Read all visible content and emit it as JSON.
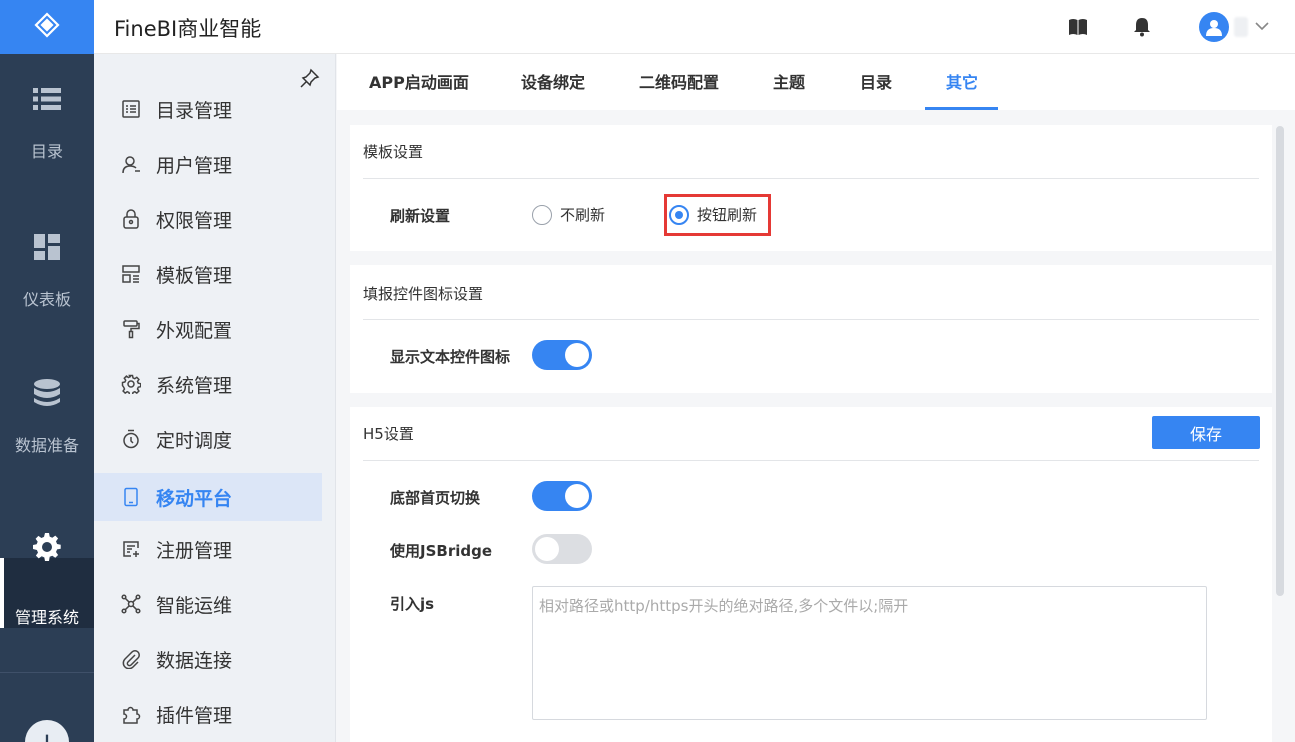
{
  "app": {
    "title": "FineBI商业智能"
  },
  "rail": {
    "items": [
      {
        "label": "目录",
        "icon": "list-icon"
      },
      {
        "label": "仪表板",
        "icon": "dashboard-icon"
      },
      {
        "label": "数据准备",
        "icon": "database-icon"
      },
      {
        "label": "管理系统",
        "icon": "gear-icon",
        "active": true
      }
    ],
    "add_label": "+"
  },
  "submenu": {
    "items": [
      {
        "label": "目录管理",
        "icon": "catalog-icon"
      },
      {
        "label": "用户管理",
        "icon": "user-icon"
      },
      {
        "label": "权限管理",
        "icon": "lock-icon"
      },
      {
        "label": "模板管理",
        "icon": "template-icon"
      },
      {
        "label": "外观配置",
        "icon": "paint-roller-icon"
      },
      {
        "label": "系统管理",
        "icon": "settings-icon"
      },
      {
        "label": "定时调度",
        "icon": "stopwatch-icon"
      },
      {
        "label": "移动平台",
        "icon": "mobile-icon",
        "active": true
      },
      {
        "label": "注册管理",
        "icon": "register-icon"
      },
      {
        "label": "智能运维",
        "icon": "network-icon"
      },
      {
        "label": "数据连接",
        "icon": "paperclip-icon"
      },
      {
        "label": "插件管理",
        "icon": "puzzle-icon"
      }
    ]
  },
  "tabs": [
    {
      "label": "APP启动画面"
    },
    {
      "label": "设备绑定"
    },
    {
      "label": "二维码配置"
    },
    {
      "label": "主题"
    },
    {
      "label": "目录"
    },
    {
      "label": "其它",
      "active": true
    }
  ],
  "template_settings": {
    "title": "模板设置",
    "refresh_label": "刷新设置",
    "options": [
      {
        "label": "不刷新",
        "checked": false
      },
      {
        "label": "按钮刷新",
        "checked": true
      }
    ]
  },
  "widget_settings": {
    "title": "填报控件图标设置",
    "show_icon_label": "显示文本控件图标",
    "show_icon_on": true
  },
  "h5_settings": {
    "title": "H5设置",
    "save_label": "保存",
    "bottom_switch_label": "底部首页切换",
    "bottom_switch_on": true,
    "jsbridge_label": "使用JSBridge",
    "jsbridge_on": false,
    "import_js_label": "引入js",
    "import_js_value": "",
    "import_js_placeholder": "相对路径或http/https开头的绝对路径,多个文件以;隔开"
  },
  "colors": {
    "accent": "#3685f2",
    "rail": "#2c3e55",
    "highlight": "#e53935"
  }
}
